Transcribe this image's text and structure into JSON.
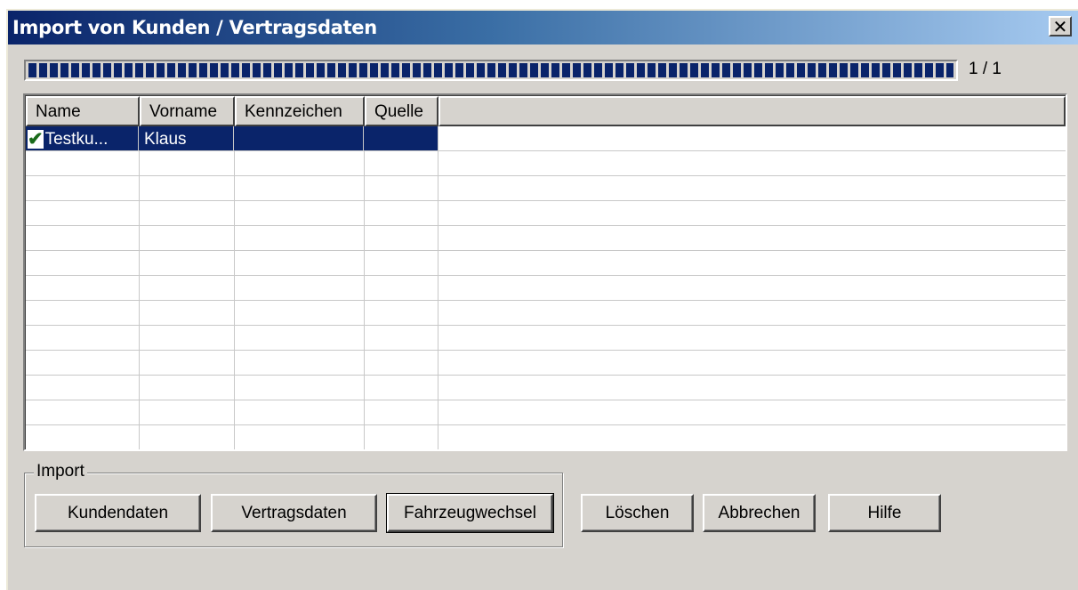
{
  "window": {
    "title": "Import von Kunden / Vertragsdaten",
    "close_glyph": "✕"
  },
  "progress": {
    "value": 1.0,
    "counter": "1 / 1"
  },
  "list": {
    "columns": [
      "Name",
      "Vorname",
      "Kennzeichen",
      "Quelle"
    ],
    "rows": [
      {
        "status_icon": "checkmark-icon",
        "name": "Testku...",
        "vorname": "Klaus",
        "kennzeichen": "",
        "quelle": "",
        "selected": true
      }
    ]
  },
  "import_group": {
    "label": "Import",
    "buttons": {
      "kundendaten": "Kundendaten",
      "vertragsdaten": "Vertragsdaten",
      "fahrzeugwechsel": "Fahrzeugwechsel"
    }
  },
  "actions": {
    "loeschen": "Löschen",
    "abbrechen": "Abbrechen",
    "hilfe": "Hilfe"
  },
  "colors": {
    "titlebar_start": "#0a246a",
    "titlebar_end": "#a6caf0",
    "selection": "#0a246a",
    "checkmark": "#1a6b1a",
    "face": "#d6d3ce"
  }
}
